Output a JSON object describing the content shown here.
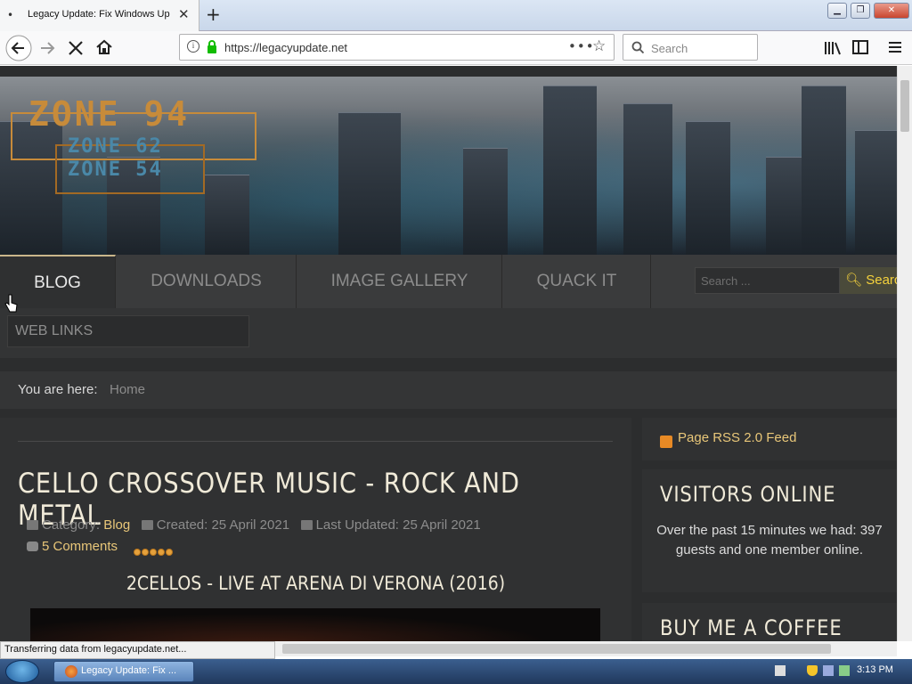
{
  "browser": {
    "tab_title": "Legacy Update: Fix Windows Up",
    "tab_dot": "•",
    "tab_close": "✕",
    "new_tab": "+",
    "url": "https://legacyupdate.net",
    "search_placeholder": "Search",
    "page_actions": "•••",
    "status": "Transferring data from legacyupdate.net..."
  },
  "banner": {
    "logo_main": "ZONE 94",
    "logo_sub1": "ZONE 62",
    "logo_sub2": "ZONE 54"
  },
  "menu": {
    "items": [
      "BLOG",
      "DOWNLOADS",
      "IMAGE GALLERY",
      "QUACK IT"
    ],
    "search_placeholder": "Search ...",
    "search_button": "Search",
    "submenu": "WEB LINKS"
  },
  "breadcrumb": {
    "label": "You are here:",
    "home": "Home"
  },
  "article": {
    "title": "CELLO CROSSOVER MUSIC - ROCK AND METAL",
    "category_label": "Category:",
    "category": "Blog",
    "created": "Created: 25 April 2021",
    "updated": "Last Updated: 25 April 2021",
    "comments": "5 Comments",
    "rating": 5,
    "subtitle": "2CELLOS - LIVE AT ARENA DI VERONA (2016)"
  },
  "sidebar": {
    "rss": "Page RSS 2.0 Feed",
    "visitors_title": "VISITORS ONLINE",
    "visitors_text": "Over the past 15 minutes we had: 397 guests and one member online.",
    "coffee_title": "BUY ME A COFFEE"
  },
  "taskbar": {
    "task_label": "Legacy Update: Fix ...",
    "clock": "3:13 PM"
  },
  "colors": {
    "accent": "#e9c779",
    "page_bg": "#2c2d2e",
    "search_button": "#f5d23c"
  }
}
